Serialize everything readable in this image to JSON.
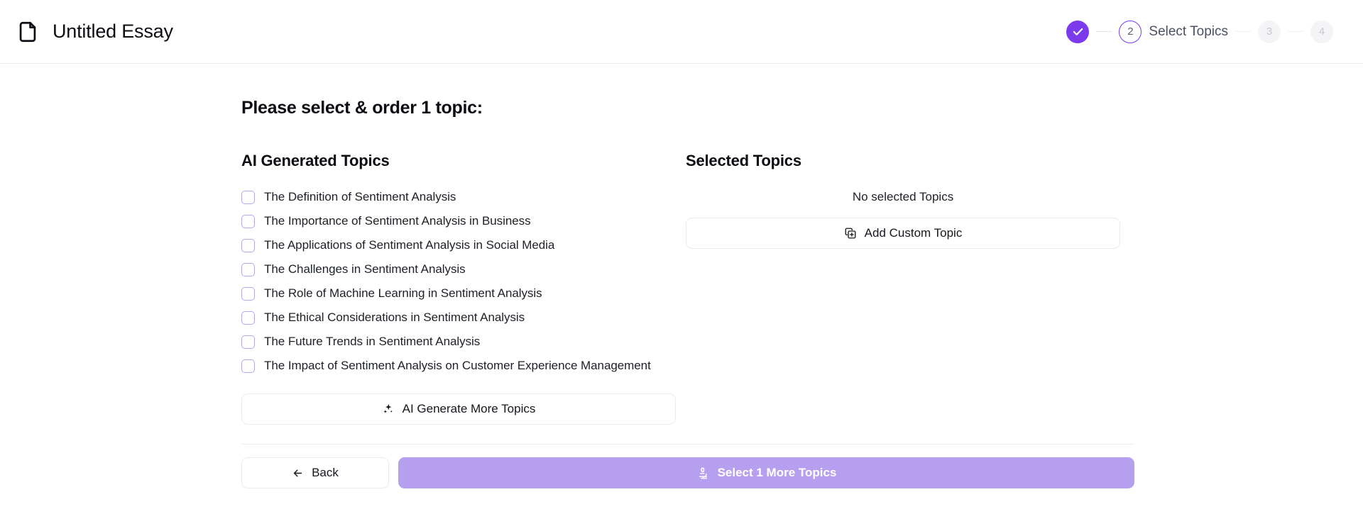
{
  "header": {
    "doc_icon": "file-document-icon",
    "title": "Untitled Essay"
  },
  "stepper": {
    "steps": [
      {
        "id": "1",
        "label": "",
        "state": "done",
        "icon": "check-icon"
      },
      {
        "id": "2",
        "label": "Select Topics",
        "state": "active"
      },
      {
        "id": "3",
        "label": "",
        "state": "muted"
      },
      {
        "id": "4",
        "label": "",
        "state": "muted"
      }
    ],
    "accent_color": "#7c3aed",
    "muted_color": "#c7c9d1"
  },
  "main": {
    "heading_prefix": "Please select & order ",
    "heading_count": "1",
    "heading_suffix": " topic:",
    "left": {
      "title": "AI Generated Topics",
      "topics": [
        {
          "label": "The Definition of Sentiment Analysis",
          "checked": false
        },
        {
          "label": "The Importance of Sentiment Analysis in Business",
          "checked": false
        },
        {
          "label": "The Applications of Sentiment Analysis in Social Media",
          "checked": false
        },
        {
          "label": "The Challenges in Sentiment Analysis",
          "checked": false
        },
        {
          "label": "The Role of Machine Learning in Sentiment Analysis",
          "checked": false
        },
        {
          "label": "The Ethical Considerations in Sentiment Analysis",
          "checked": false
        },
        {
          "label": "The Future Trends in Sentiment Analysis",
          "checked": false
        },
        {
          "label": "The Impact of Sentiment Analysis on Customer Experience Management",
          "checked": false
        }
      ],
      "generate_more_label": "AI Generate More Topics",
      "generate_more_icon": "sparkles-icon"
    },
    "right": {
      "title": "Selected Topics",
      "empty_text": "No selected Topics",
      "add_custom_label": "Add Custom Topic",
      "add_custom_icon": "copy-plus-icon"
    }
  },
  "footer": {
    "back_label": "Back",
    "back_icon": "arrow-left-icon",
    "primary_label": "Select 1 More Topics",
    "primary_icon": "microscope-icon",
    "primary_color": "#b79ff0"
  }
}
